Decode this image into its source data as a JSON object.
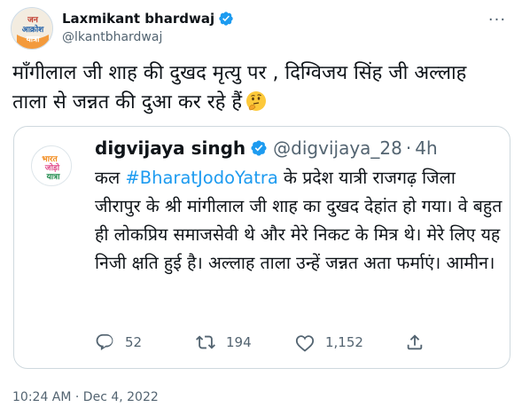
{
  "author": {
    "display_name": "Laxmikant bhardwaj",
    "handle": "@lkantbhardwaj",
    "avatar_text": "जन आक्रोश यात्रा",
    "verified_icon": "verified-badge-icon"
  },
  "tweet": {
    "text_line1": "माँगीलाल जी शाह की दुखद मृत्यु पर , दिग्विजय सिंह जी अल्लाह",
    "text_line2": "ताला से जन्नत की दुआ कर रहे हैं",
    "emoji": "thinking-face-icon"
  },
  "quoted_tweet": {
    "display_name": "digvijaya singh",
    "handle": "@digvijaya_28",
    "separator": "·",
    "time": "4h",
    "avatar_text": "भारत जोड़ो यात्रा",
    "text_prefix": "कल ",
    "hashtag": "#BharatJodoYatra",
    "text_rest": " के प्रदेश यात्री राजगढ़ जिला जीरापुर के श्री मांगीलाल जी शाह का दुखद देहांत हो गया। वे बहुत ही लोकप्रिय समाजसेवी थे और मेरे निकट के मित्र थे। मेरे लिए यह निजी क्षति हुई है। अल्लाह ताला उन्हें जन्नत अता फर्माएं। आमीन।",
    "reply_count": "52",
    "retweet_count": "194",
    "like_count": "1,152"
  },
  "footer": {
    "timestamp": "10:24 AM · Dec 4, 2022"
  },
  "colors": {
    "accent": "#1d9bf0",
    "muted": "#536471",
    "border": "#cfd9de"
  }
}
